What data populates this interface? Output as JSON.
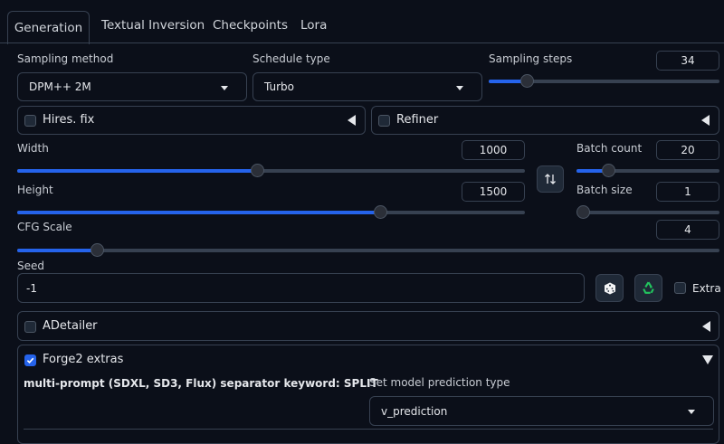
{
  "tabs": [
    {
      "label": "Generation",
      "active": true
    },
    {
      "label": "Textual Inversion"
    },
    {
      "label": "Checkpoints"
    },
    {
      "label": "Lora"
    }
  ],
  "sampling": {
    "method_label": "Sampling method",
    "method_value": "DPM++ 2M",
    "schedule_label": "Schedule type",
    "schedule_value": "Turbo",
    "steps_label": "Sampling steps",
    "steps_value": "34",
    "steps_fraction": 0.17
  },
  "hires": {
    "label": "Hires. fix",
    "checked": false
  },
  "refiner": {
    "label": "Refiner",
    "checked": false
  },
  "width": {
    "label": "Width",
    "value": "1000",
    "fraction": 0.475
  },
  "height": {
    "label": "Height",
    "value": "1500",
    "fraction": 0.717
  },
  "swap_icon": "swap-vertical-icon",
  "batch_count": {
    "label": "Batch count",
    "value": "20",
    "fraction": 0.23
  },
  "batch_size": {
    "label": "Batch size",
    "value": "1",
    "fraction": 0.0
  },
  "cfg": {
    "label": "CFG Scale",
    "value": "4",
    "fraction": 0.115
  },
  "seed": {
    "label": "Seed",
    "value": "-1",
    "dice_icon": "dice-icon",
    "recycle_icon": "recycle-icon",
    "extra_label": "Extra",
    "extra_checked": false
  },
  "adetailer": {
    "label": "ADetailer",
    "checked": false
  },
  "forge2": {
    "label": "Forge2 extras",
    "checked": true,
    "multiprompt_text": "multi-prompt (SDXL, SD3, Flux) separator keyword: SPLIT",
    "prediction_label": "Set model prediction type",
    "prediction_value": "v_prediction"
  },
  "colors": {
    "accent": "#2563eb",
    "background": "#0b0f19",
    "border": "#374151",
    "recycle_green": "#22c55e"
  }
}
